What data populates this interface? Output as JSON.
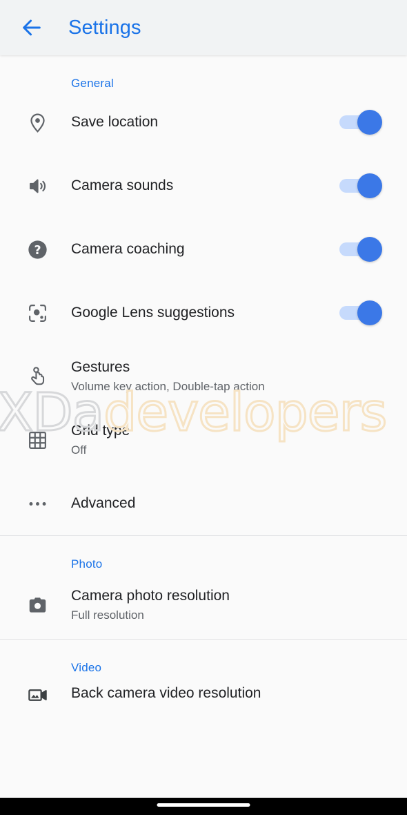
{
  "appbar": {
    "back_icon": "arrow-back-icon",
    "title": "Settings",
    "accent_color": "#1a73e8",
    "background_color": "#f1f3f4"
  },
  "theme": {
    "body_background": "#fafafa",
    "title_text_color": "#202124",
    "subtitle_text_color": "#5f6368",
    "icon_color": "#5f6368",
    "switch_track_on": "#c6dafc",
    "switch_thumb_on": "#3b78e7",
    "divider_color": "#e2e3e5"
  },
  "sections": [
    {
      "title": "General",
      "rows": [
        {
          "icon": "location-pin-icon",
          "title": "Save location",
          "subtitle": "",
          "control": "switch",
          "switch_state": "on"
        },
        {
          "icon": "volume-up-icon",
          "title": "Camera sounds",
          "subtitle": "",
          "control": "switch",
          "switch_state": "on"
        },
        {
          "icon": "help-circle-icon",
          "title": "Camera coaching",
          "subtitle": "",
          "control": "switch",
          "switch_state": "on"
        },
        {
          "icon": "google-lens-icon",
          "title": "Google Lens suggestions",
          "subtitle": "",
          "control": "switch",
          "switch_state": "on"
        },
        {
          "icon": "gesture-tap-icon",
          "title": "Gestures",
          "subtitle": "Volume key action, Double-tap action",
          "control": "none",
          "switch_state": ""
        },
        {
          "icon": "grid-icon",
          "title": "Grid type",
          "subtitle": "Off",
          "control": "none",
          "switch_state": ""
        },
        {
          "icon": "more-horizontal-icon",
          "title": "Advanced",
          "subtitle": "",
          "control": "none",
          "switch_state": ""
        }
      ]
    },
    {
      "title": "Photo",
      "rows": [
        {
          "icon": "camera-icon",
          "title": "Camera photo resolution",
          "subtitle": "Full resolution",
          "control": "none",
          "switch_state": ""
        }
      ]
    },
    {
      "title": "Video",
      "rows": [
        {
          "icon": "video-camera-icon",
          "title": "Back camera video resolution",
          "subtitle": "",
          "control": "none",
          "switch_state": ""
        }
      ]
    }
  ],
  "watermark": {
    "part1": "XDa",
    "part2": "developers",
    "part1_color": "#d7d8da",
    "part2_color": "#f6e3c4"
  },
  "navbar": {
    "pill": "home-gesture-pill",
    "background_color": "#000000"
  }
}
